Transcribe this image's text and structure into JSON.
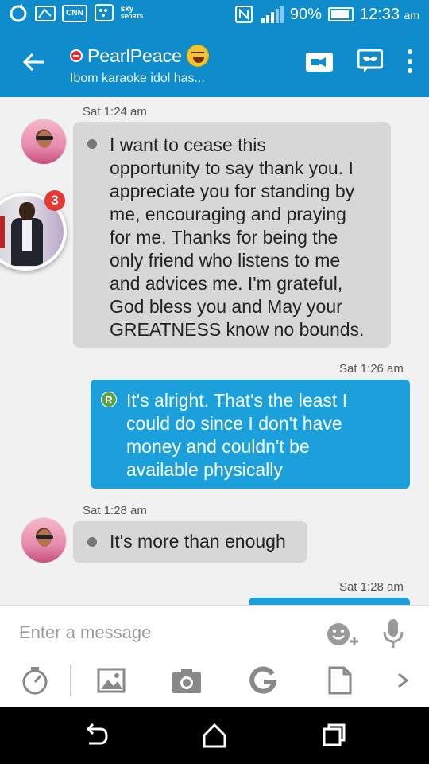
{
  "status_bar": {
    "left_icons": [
      "sync-icon",
      "news-icon",
      "cnn-icon",
      "bbm-icon",
      "sky-sports-icon"
    ],
    "cnn_label": "CNN",
    "sky_label": "sky",
    "sports_label": "SPORTS",
    "battery_text": "90%",
    "battery_level": 0.9,
    "time": "12:33",
    "ampm": "am"
  },
  "app_bar": {
    "contact_name": "PearlPeace",
    "contact_status": "Ibom karaoke idol has..."
  },
  "messages": [
    {
      "direction": "in",
      "timestamp": "Sat 1:24 am",
      "lines": [
        "I want to cease this",
        "opportunity to say thank you. I",
        "appreciate you for standing by",
        "me, encouraging and praying",
        "for me. Thanks for being the",
        "only friend who listens to me",
        "and advices me. I'm grateful,",
        "God bless you and May your",
        "GREATNESS know no bounds."
      ]
    },
    {
      "direction": "out",
      "timestamp": "Sat 1:26 am",
      "badge": "R",
      "lines": [
        "It's alright. That's the least I",
        "could do since I don't have",
        "money and couldn't be",
        "available physically"
      ]
    },
    {
      "direction": "in",
      "timestamp": "Sat 1:28 am",
      "lines": [
        "It's more than enough"
      ]
    },
    {
      "direction": "out",
      "timestamp": "Sat 1:28 am",
      "lines": []
    }
  ],
  "chat_head": {
    "badge_count": "3"
  },
  "compose": {
    "placeholder": "Enter a message",
    "tools": [
      "timer-icon",
      "gallery-icon",
      "camera-icon",
      "g-icon",
      "file-icon",
      "chevron-right-icon"
    ]
  },
  "nav_bar": {
    "buttons": [
      "back-icon",
      "home-icon",
      "recents-icon"
    ]
  },
  "colors": {
    "accent": "#0f8ccc",
    "outgoing_bubble": "#1ba0dc",
    "incoming_bubble": "#d7d7d7",
    "badge_red": "#e53935"
  }
}
